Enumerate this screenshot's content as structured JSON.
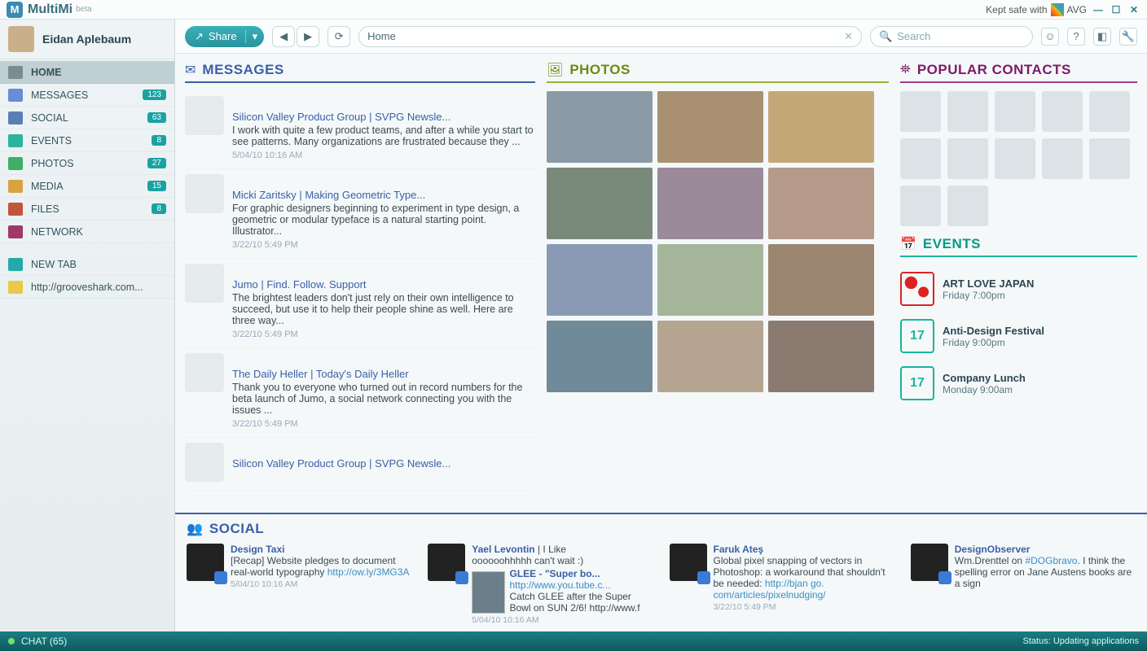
{
  "titlebar": {
    "brand": "MultiMi",
    "beta": "beta",
    "kept": "Kept safe with",
    "avg": "AVG"
  },
  "profile": {
    "name": "Eidan Aplebaum"
  },
  "nav": [
    {
      "label": "HOME",
      "icon": "ic-home",
      "badge": null,
      "sel": true
    },
    {
      "label": "MESSAGES",
      "icon": "ic-msg",
      "badge": "123"
    },
    {
      "label": "SOCIAL",
      "icon": "ic-soc",
      "badge": "63"
    },
    {
      "label": "EVENTS",
      "icon": "ic-evt",
      "badge": "8"
    },
    {
      "label": "PHOTOS",
      "icon": "ic-pho",
      "badge": "27"
    },
    {
      "label": "MEDIA",
      "icon": "ic-med",
      "badge": "15"
    },
    {
      "label": "FILES",
      "icon": "ic-fil",
      "badge": "8"
    },
    {
      "label": "NETWORK",
      "icon": "ic-net",
      "badge": null
    }
  ],
  "nav_extra": [
    {
      "label": "NEW TAB",
      "icon": "ic-add"
    },
    {
      "label": "http://grooveshark.com...",
      "icon": "ic-lnk"
    }
  ],
  "toolbar": {
    "share": "Share",
    "address": "Home",
    "search": "Search"
  },
  "sections": {
    "messages": "MESSAGES",
    "photos": "PHOTOS",
    "popular": "POPULAR CONTACTS",
    "events": "EVENTS",
    "social": "SOCIAL"
  },
  "messages": [
    {
      "title": "Silicon Valley Product Group | SVPG Newsle...",
      "body": "I work with quite a few product teams, and after a while you start to see patterns. Many organizations are frustrated because they ...",
      "time": "5/04/10 10:16 AM"
    },
    {
      "title": "Micki Zaritsky | Making Geometric Type...",
      "body": "For graphic designers beginning to experiment in type design, a geometric or modular typeface is a natural starting point. Illustrator...",
      "time": "3/22/10 5:49 PM"
    },
    {
      "title": "Jumo | Find. Follow. Support",
      "body": "The brightest leaders don't just rely on their own intelligence to succeed, but use it to help their people shine as well. Here are three way...",
      "time": "3/22/10 5:49 PM"
    },
    {
      "title": "The Daily Heller | Today's Daily Heller",
      "body": "Thank you to everyone who turned out in record numbers for the beta launch of Jumo, a social network connecting you with the issues ...",
      "time": "3/22/10 5:49 PM"
    },
    {
      "title": "Silicon Valley Product Group | SVPG Newsle...",
      "body": "",
      "time": ""
    }
  ],
  "events": [
    {
      "name": "ART LOVE JAPAN",
      "time": "Friday 7:00pm",
      "art": true
    },
    {
      "name": "Anti-Design Festival",
      "time": "Friday 9:00pm",
      "day": "17"
    },
    {
      "name": "Company Lunch",
      "time": "Monday 9:00am",
      "day": "17"
    }
  ],
  "social": [
    {
      "name": "Design Taxi",
      "body": "[Recap] Website pledges to document real-world typography",
      "link": "http://ow.ly/3MG3A",
      "time": "5/04/10 10:16 AM"
    },
    {
      "name": "Yael Levontin",
      "extra": "| I Like",
      "body": "oooooohhhhh can't wait :)",
      "glee": "GLEE - \"Super bo...",
      "gleelink": "http://www.you.tube.c...",
      "gleebody": "Catch GLEE after the Super Bowl on SUN 2/6! http://www.f",
      "time": "5/04/10 10:16 AM"
    },
    {
      "name": "Faruk Ateş",
      "body": "Global pixel snapping of vectors in Photoshop: a workaround that shouldn't be needed:",
      "link": "http://bjan go. com/articles/pixelnudging/",
      "time": "3/22/10 5:49 PM"
    },
    {
      "name": "DesignObserver",
      "body": "Wm.Drenttel on",
      "link": "#DOGbravo",
      "body2": ". I think the spelling error on Jane Austens books are a sign",
      "time": ""
    }
  ],
  "chat": {
    "label": "CHAT (65)",
    "status": "Status: Updating applications"
  }
}
